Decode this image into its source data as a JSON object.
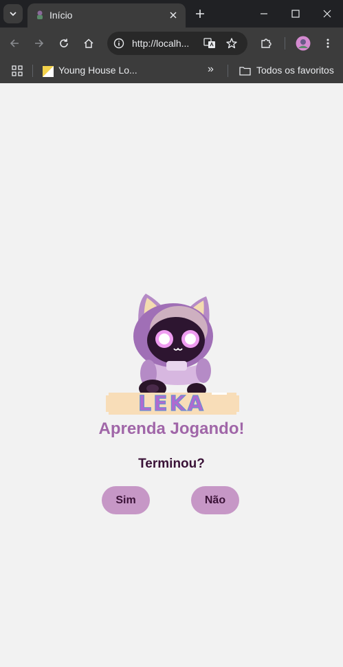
{
  "browser": {
    "tab_title": "Início",
    "address": "http://localh...",
    "bookmark_item": "Young House Lo...",
    "more_bookmarks": "»",
    "all_bookmarks": "Todos os favoritos"
  },
  "page": {
    "logo_text": "LEKA",
    "subtitle": "Aprenda Jogando!",
    "question": "Terminou?",
    "yes_label": "Sim",
    "no_label": "Não"
  },
  "colors": {
    "accent": "#a066a8",
    "button_bg": "#c697c6",
    "text_dark": "#3a1237"
  }
}
